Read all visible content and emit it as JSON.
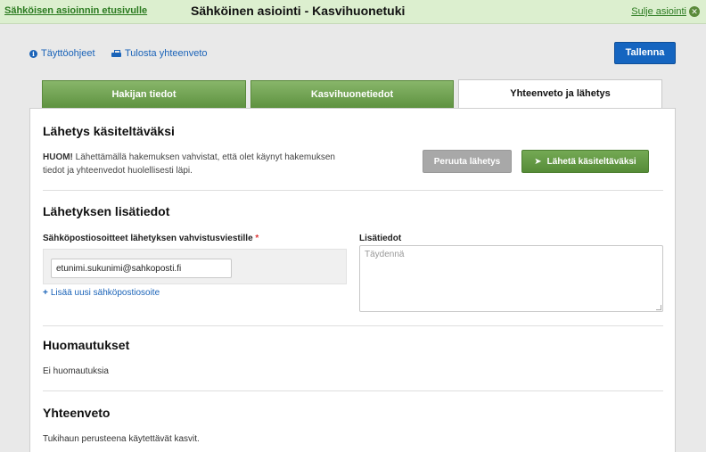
{
  "header": {
    "home_link": "Sähköisen asioinnin etusivulle",
    "title": "Sähköinen asiointi - Kasvihuonetuki",
    "close_link": "Sulje asiointi"
  },
  "toolbar": {
    "instructions": "Täyttöohjeet",
    "print": "Tulosta yhteenveto",
    "save": "Tallenna"
  },
  "tabs": [
    {
      "label": "Hakijan tiedot",
      "active": false
    },
    {
      "label": "Kasvihuonetiedot",
      "active": false
    },
    {
      "label": "Yhteenveto ja lähetys",
      "active": true
    }
  ],
  "submission": {
    "title": "Lähetys käsiteltäväksi",
    "notice_bold": "HUOM!",
    "notice_text": " Lähettämällä hakemuksen vahvistat, että olet käynyt hakemuksen tiedot ja yhteenvedot huolellisesti läpi.",
    "cancel_button": "Peruuta lähetys",
    "send_button": "Lähetä käsiteltäväksi"
  },
  "additional_info": {
    "title": "Lähetyksen lisätiedot",
    "email_label": "Sähköpostiosoitteet lähetyksen vahvistusviestille",
    "required_mark": "*",
    "email_value": "etunimi.sukunimi@sahkoposti.fi",
    "add_email_link": "Lisää uusi sähköpostiosoite",
    "notes_label": "Lisätiedot",
    "notes_placeholder": "Täydennä"
  },
  "remarks": {
    "title": "Huomautukset",
    "text": "Ei huomautuksia"
  },
  "summary": {
    "title": "Yhteenveto",
    "text": "Tukihaun perusteena käytettävät kasvit."
  },
  "colors": {
    "brand_green": "#5e9240",
    "primary_blue": "#1565c0",
    "link_blue": "#1a63b8"
  }
}
